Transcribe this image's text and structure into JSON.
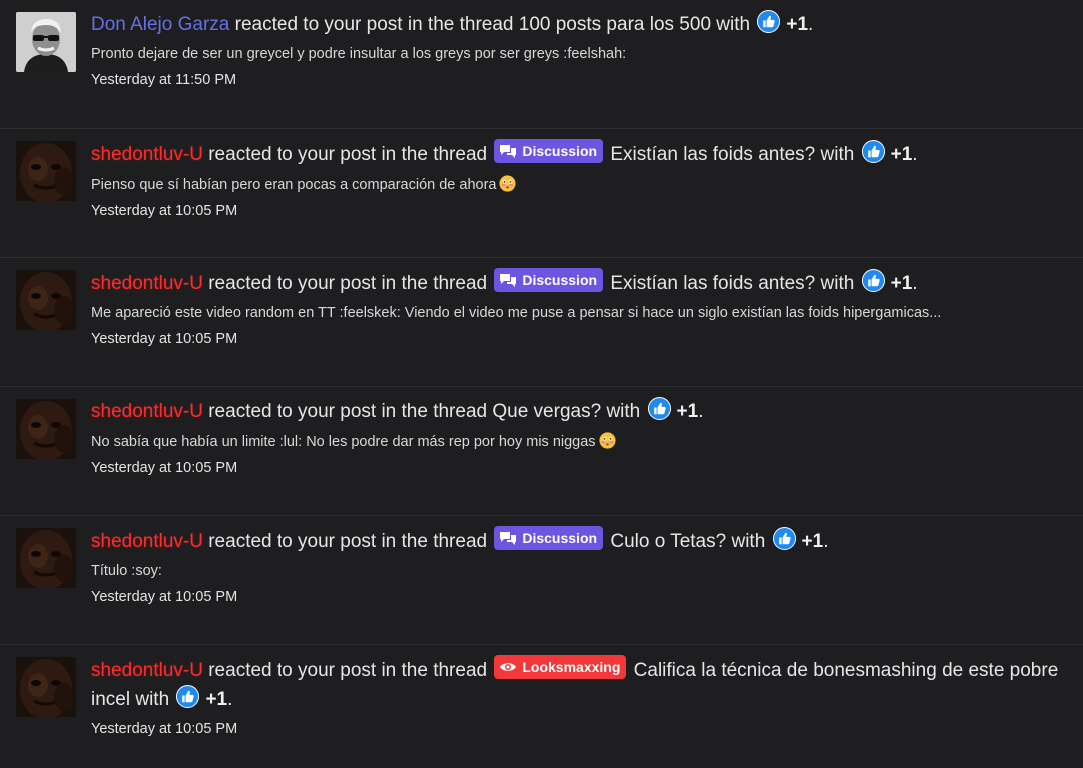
{
  "alerts": [
    {
      "user": "Don Alejo Garza",
      "user_style": "blue",
      "avatar": "man-with-sunglasses-avatar",
      "action": "reacted to your post in the thread",
      "prefix": null,
      "thread": "100 posts para los 500",
      "with": "with",
      "reaction": "+1",
      "period": ".",
      "snippet": "Pronto dejare de ser un greycel y podre insultar a los greys por ser greys :feelshah:",
      "snippet_emoji": null,
      "time": "Yesterday at 11:50 PM"
    },
    {
      "user": "shedontluv-U",
      "user_style": "red",
      "avatar": "dark-face-avatar",
      "action": "reacted to your post in the thread",
      "prefix": "Discussion",
      "thread": "Existían las foids antes?",
      "with": "with",
      "reaction": "+1",
      "period": ".",
      "snippet": "Pienso que sí habían pero eran pocas a comparación de ahora",
      "snippet_emoji": "flushed-face-emoji",
      "time": "Yesterday at 10:05 PM"
    },
    {
      "user": "shedontluv-U",
      "user_style": "red",
      "avatar": "dark-face-avatar",
      "action": "reacted to your post in the thread",
      "prefix": "Discussion",
      "thread": "Existían las foids antes?",
      "with": "with",
      "reaction": "+1",
      "period": ".",
      "snippet": "Me apareció este video random en TT :feelskek: Viendo el video me puse a pensar si hace un siglo existían las foids hipergamicas...",
      "snippet_emoji": null,
      "time": "Yesterday at 10:05 PM"
    },
    {
      "user": "shedontluv-U",
      "user_style": "red",
      "avatar": "dark-face-avatar",
      "action": "reacted to your post in the thread",
      "prefix": null,
      "thread": "Que vergas?",
      "with": "with",
      "reaction": "+1",
      "period": ".",
      "snippet": "No sabía que había un limite :lul: No les podre dar más rep por hoy mis niggas",
      "snippet_emoji": "flushed-face-emoji",
      "time": "Yesterday at 10:05 PM"
    },
    {
      "user": "shedontluv-U",
      "user_style": "red",
      "avatar": "dark-face-avatar",
      "action": "reacted to your post in the thread",
      "prefix": "Discussion",
      "thread": "Culo o Tetas?",
      "with": "with",
      "reaction": "+1",
      "period": ".",
      "snippet": "Título :soy:",
      "snippet_emoji": null,
      "time": "Yesterday at 10:05 PM"
    },
    {
      "user": "shedontluv-U",
      "user_style": "red",
      "avatar": "dark-face-avatar",
      "action": "reacted to your post in the thread",
      "prefix": "Looksmaxxing",
      "thread": "Califica la técnica de bonesmashing de este pobre incel",
      "with": "with",
      "reaction": "+1",
      "period": ".",
      "snippet": null,
      "snippet_emoji": null,
      "time": "Yesterday at 10:05 PM"
    }
  ],
  "colors": {
    "background": "#1e1e20",
    "discussion_prefix": "#6c55e0",
    "looksmaxxing_prefix": "#f3383a",
    "username_blue": "#6272e4",
    "username_red": "#ff2a2a",
    "like_icon": "#1f8bf0"
  },
  "icons": {
    "like": "thumbs-up-like-icon",
    "discussion_prefix": "speech-bubbles-icon",
    "looksmaxxing_prefix": "eye-icon"
  }
}
